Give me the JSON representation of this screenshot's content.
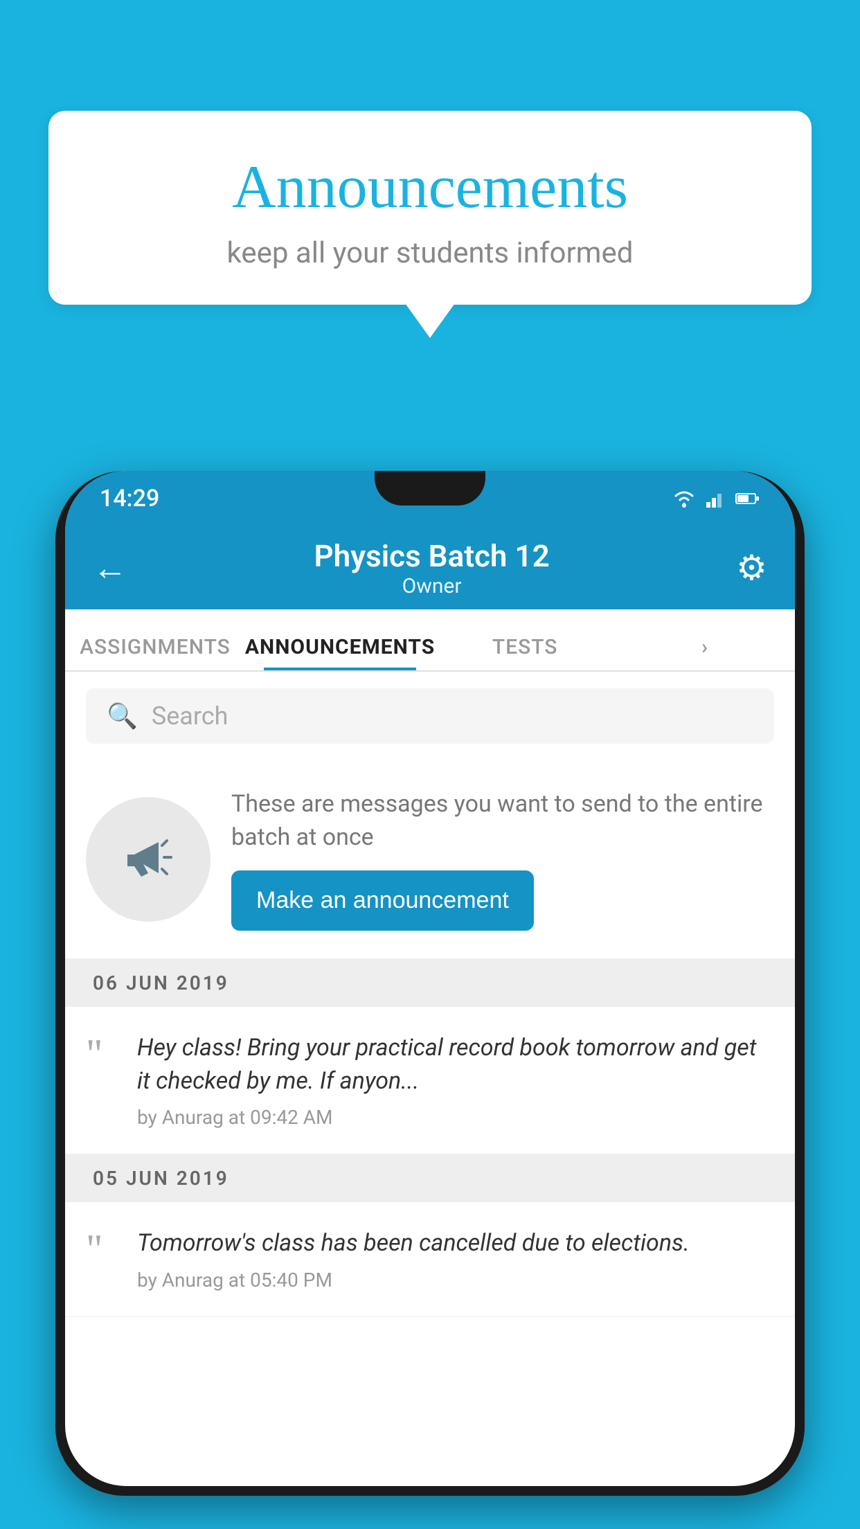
{
  "background_color": "#1ab3e0",
  "bubble": {
    "title": "Announcements",
    "subtitle": "keep all your students informed"
  },
  "status_bar": {
    "time": "14:29"
  },
  "header": {
    "title": "Physics Batch 12",
    "subtitle": "Owner",
    "back_label": "←",
    "gear_label": "⚙"
  },
  "tabs": [
    {
      "label": "ASSIGNMENTS",
      "active": false
    },
    {
      "label": "ANNOUNCEMENTS",
      "active": true
    },
    {
      "label": "TESTS",
      "active": false
    },
    {
      "label": "",
      "active": false
    }
  ],
  "search": {
    "placeholder": "Search"
  },
  "promo": {
    "text": "These are messages you want to send to the entire batch at once",
    "button_label": "Make an announcement"
  },
  "dates": [
    {
      "label": "06  JUN  2019",
      "announcements": [
        {
          "text": "Hey class! Bring your practical record book tomorrow and get it checked by me. If anyon...",
          "meta": "by Anurag at 09:42 AM"
        }
      ]
    },
    {
      "label": "05  JUN  2019",
      "announcements": [
        {
          "text": "Tomorrow's class has been cancelled due to elections.",
          "meta": "by Anurag at 05:40 PM"
        }
      ]
    }
  ]
}
